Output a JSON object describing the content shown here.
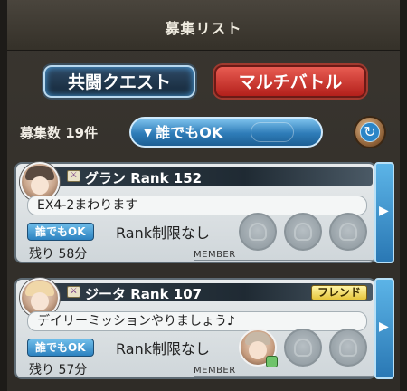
{
  "header": {
    "title": "募集リスト"
  },
  "tabs": {
    "coop": "共闘クエスト",
    "multi": "マルチバトル"
  },
  "filter": {
    "count_label": "募集数 19件",
    "filter_label": "誰でもOK"
  },
  "rooms": [
    {
      "job_icon": "dagger-icon",
      "name_rank": "グラン Rank 152",
      "comment": "EX4-2まわります",
      "tag": "誰でもOK",
      "rank_limit": "Rank制限なし",
      "remaining": "残り 58分",
      "member_label": "MEMBER",
      "friend": null
    },
    {
      "job_icon": "sword-icon",
      "name_rank": "ジータ Rank 107",
      "comment": "デイリーミッションやりましょう♪",
      "tag": "誰でもOK",
      "rank_limit": "Rank制限なし",
      "remaining": "残り 57分",
      "member_label": "MEMBER",
      "friend": "フレンド"
    }
  ],
  "colors": {
    "coop_tab": "#1f3a55",
    "multi_tab": "#d13a30",
    "accent_blue": "#2d82c0",
    "friend_gold": "#e6c53a"
  }
}
